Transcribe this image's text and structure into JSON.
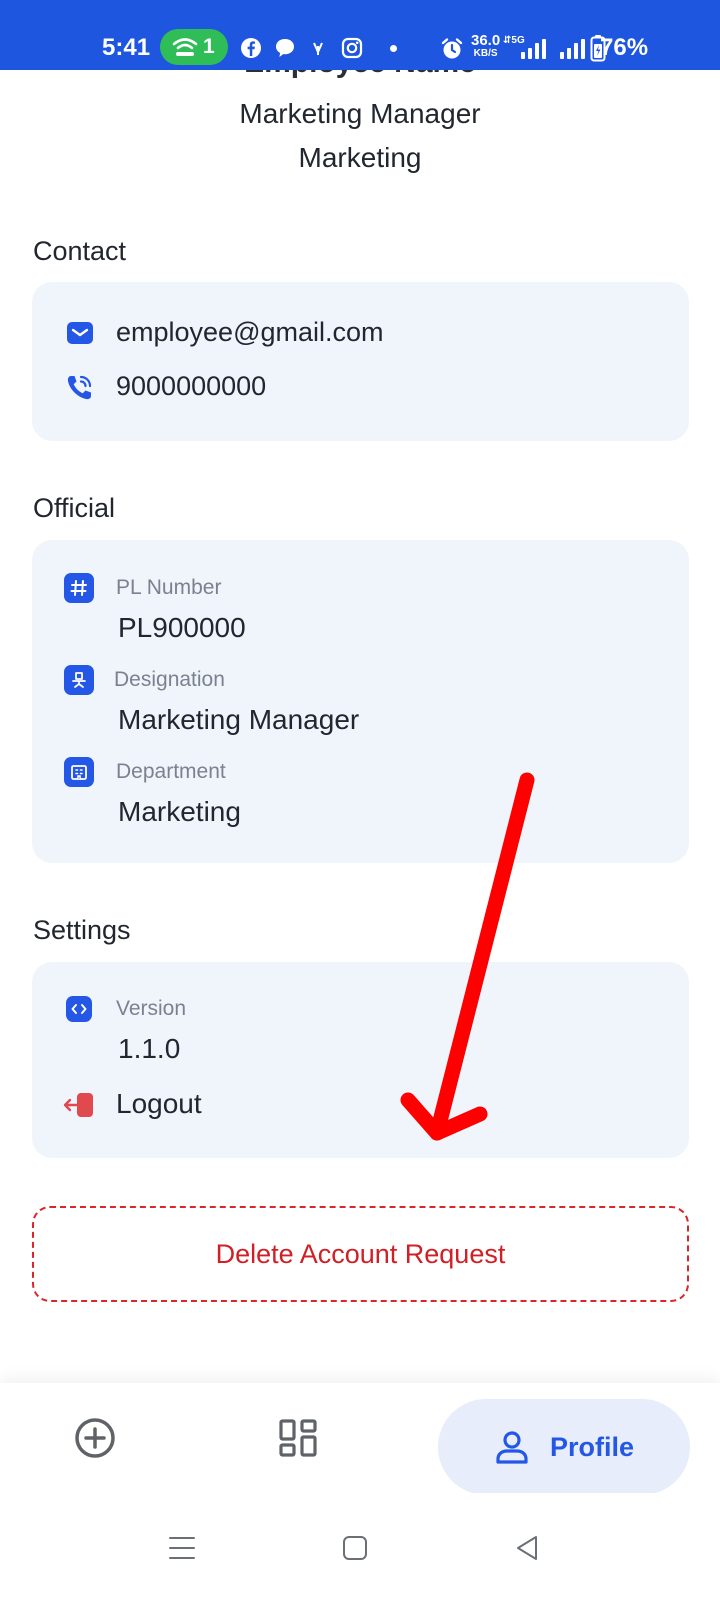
{
  "status_bar": {
    "time": "5:41",
    "hotspot_count": "1",
    "net_speed_value": "36.0",
    "net_speed_unit": "KB/S",
    "network_type": "5G",
    "battery": "76%"
  },
  "profile": {
    "name": "Employee Name",
    "role": "Marketing Manager",
    "department": "Marketing"
  },
  "contact": {
    "title": "Contact",
    "email": "employee@gmail.com",
    "phone": "9000000000"
  },
  "official": {
    "title": "Official",
    "pl_label": "PL Number",
    "pl_value": "PL900000",
    "designation_label": "Designation",
    "designation_value": "Marketing Manager",
    "department_label": "Department",
    "department_value": "Marketing"
  },
  "settings": {
    "title": "Settings",
    "version_label": "Version",
    "version_value": "1.1.0",
    "logout_label": "Logout"
  },
  "delete_request_label": "Delete Account Request",
  "bottom_nav": {
    "active_label": "Profile"
  },
  "colors": {
    "status_bar": "#1f56e0",
    "accent": "#2457e6",
    "card_bg": "#f0f5fc",
    "danger": "#d01f25",
    "annotation_arrow": "#ff0000",
    "hotspot_pill": "#2fbd58"
  },
  "icons": {
    "email": "mail-icon",
    "phone": "phone-icon",
    "pl_number": "hash-icon",
    "designation": "chair-icon",
    "department": "building-icon",
    "version": "code-icon",
    "logout": "logout-icon",
    "nav_add": "plus-circle-icon",
    "nav_dashboard": "dashboard-icon",
    "nav_profile": "user-icon"
  }
}
